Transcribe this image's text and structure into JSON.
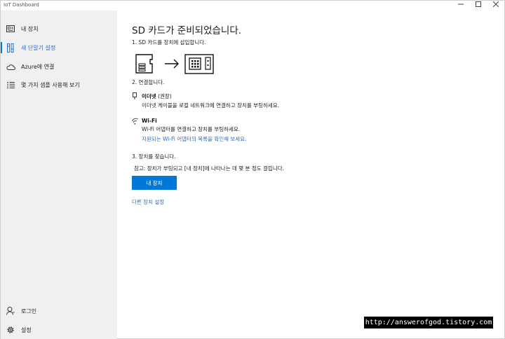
{
  "window": {
    "title": "IoT Dashboard"
  },
  "sidebar": {
    "items": [
      {
        "label": "내 장치",
        "icon": "device-icon"
      },
      {
        "label": "새 단말기 설정",
        "icon": "setup-icon"
      },
      {
        "label": "Azure에 연결",
        "icon": "cloud-icon"
      },
      {
        "label": "몇 가지 샘플 사용해 보기",
        "icon": "samples-list-icon"
      }
    ],
    "bottom": [
      {
        "label": "로그인",
        "icon": "person-icon"
      },
      {
        "label": "설정",
        "icon": "gear-icon"
      }
    ]
  },
  "main": {
    "title": "SD 카드가 준비되었습니다.",
    "step1": "1. SD 카드를 장치에 삽입합니다.",
    "step2": "2. 연결합니다.",
    "ethernet": {
      "title": "이더넷",
      "note": "(권장)",
      "desc": "이더넷 케이블을 로컬 네트워크에 연결하고 장치를 부팅하세요."
    },
    "wifi": {
      "title": "Wi-Fi",
      "desc": "Wi-Fi 어댑터를 연결하고 장치를 부팅하세요.",
      "link": "지원되는 Wi-Fi 어댑터의 목록을 확인해 보세요."
    },
    "step3": "3. 장치를 찾습니다.",
    "note": "참고: 장치가 부팅되고 [내 장치]에 나타나는 데 몇 분 정도 걸립니다.",
    "button": "내 장치",
    "other_link": "다른 장치 설정"
  },
  "watermark": "http://answerofgod.tistory.com",
  "colors": {
    "accent": "#0078d7",
    "link": "#2b6ec0",
    "sidebar_bg": "#f0f0f0"
  }
}
